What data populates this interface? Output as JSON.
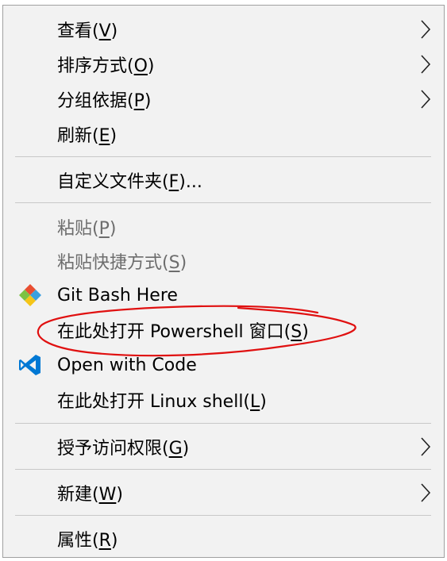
{
  "menu": {
    "items": [
      {
        "label": "查看(V)",
        "submenu": true,
        "disabled": false
      },
      {
        "label": "排序方式(O)",
        "submenu": true,
        "disabled": false
      },
      {
        "label": "分组依据(P)",
        "submenu": true,
        "disabled": false
      },
      {
        "label": "刷新(E)",
        "submenu": false,
        "disabled": false
      },
      {
        "label": "自定义文件夹(F)...",
        "submenu": false,
        "disabled": false
      },
      {
        "label": "粘贴(P)",
        "submenu": false,
        "disabled": true
      },
      {
        "label": "粘贴快捷方式(S)",
        "submenu": false,
        "disabled": true
      },
      {
        "label": "Git Bash Here",
        "submenu": false,
        "disabled": false,
        "icon": "git-bash-icon"
      },
      {
        "label": "在此处打开 Powershell 窗口(S)",
        "submenu": false,
        "disabled": false
      },
      {
        "label": "Open with Code",
        "submenu": false,
        "disabled": false,
        "icon": "vscode-icon"
      },
      {
        "label": "在此处打开 Linux shell(L)",
        "submenu": false,
        "disabled": false
      },
      {
        "label": "授予访问权限(G)",
        "submenu": true,
        "disabled": false
      },
      {
        "label": "新建(W)",
        "submenu": true,
        "disabled": false
      },
      {
        "label": "属性(R)",
        "submenu": false,
        "disabled": false
      }
    ]
  },
  "colors": {
    "menu_background": "#f2f2f2",
    "disabled_text": "#6d6d6d",
    "annotation_red": "#e01010",
    "vscode_blue": "#0078d4"
  }
}
